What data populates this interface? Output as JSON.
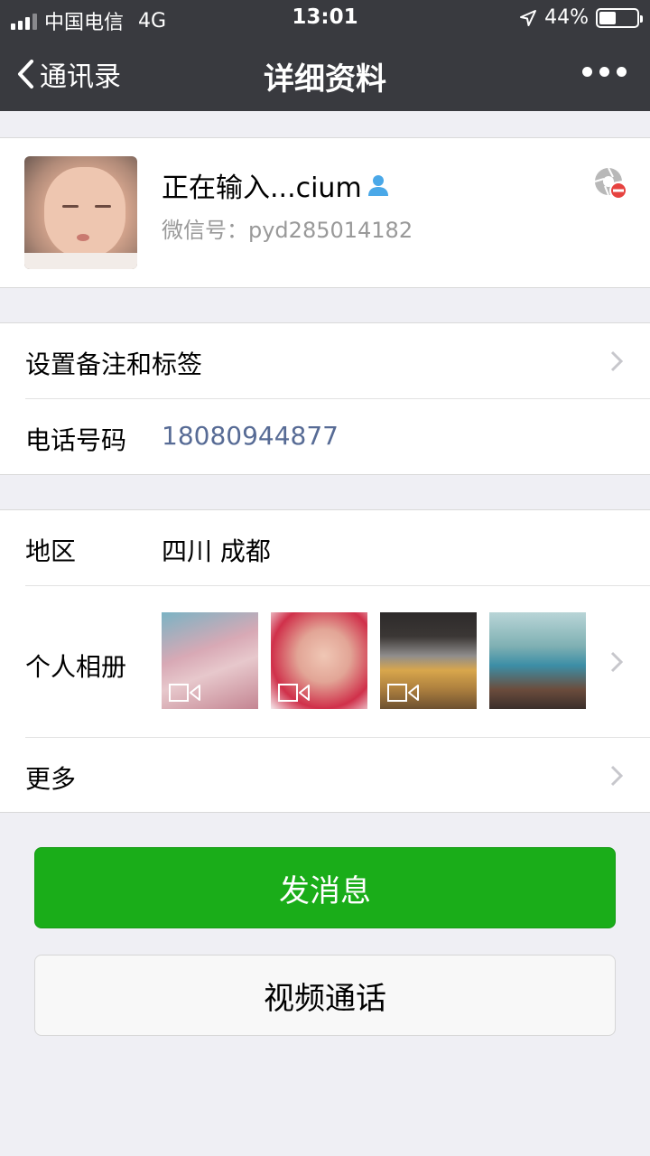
{
  "status_bar": {
    "carrier": "中国电信",
    "network": "4G",
    "time": "13:01",
    "battery": "44%",
    "battery_level": 0.44
  },
  "nav": {
    "back_label": "通讯录",
    "title": "详细资料"
  },
  "profile": {
    "nickname": "正在输入...cium",
    "wechat_id": "微信号：pyd285014182"
  },
  "rows": {
    "remark_label": "设置备注和标签",
    "phone_label": "电话号码",
    "phone_value": "18080944877",
    "region_label": "地区",
    "region_value": "四川 成都",
    "album_label": "个人相册",
    "more_label": "更多"
  },
  "buttons": {
    "send_message": "发消息",
    "video_call": "视频通话"
  },
  "colors": {
    "nav_bg": "#393a3f",
    "accent_green": "#1aad19",
    "link_blue": "#576b95",
    "page_bg": "#efeff4"
  }
}
